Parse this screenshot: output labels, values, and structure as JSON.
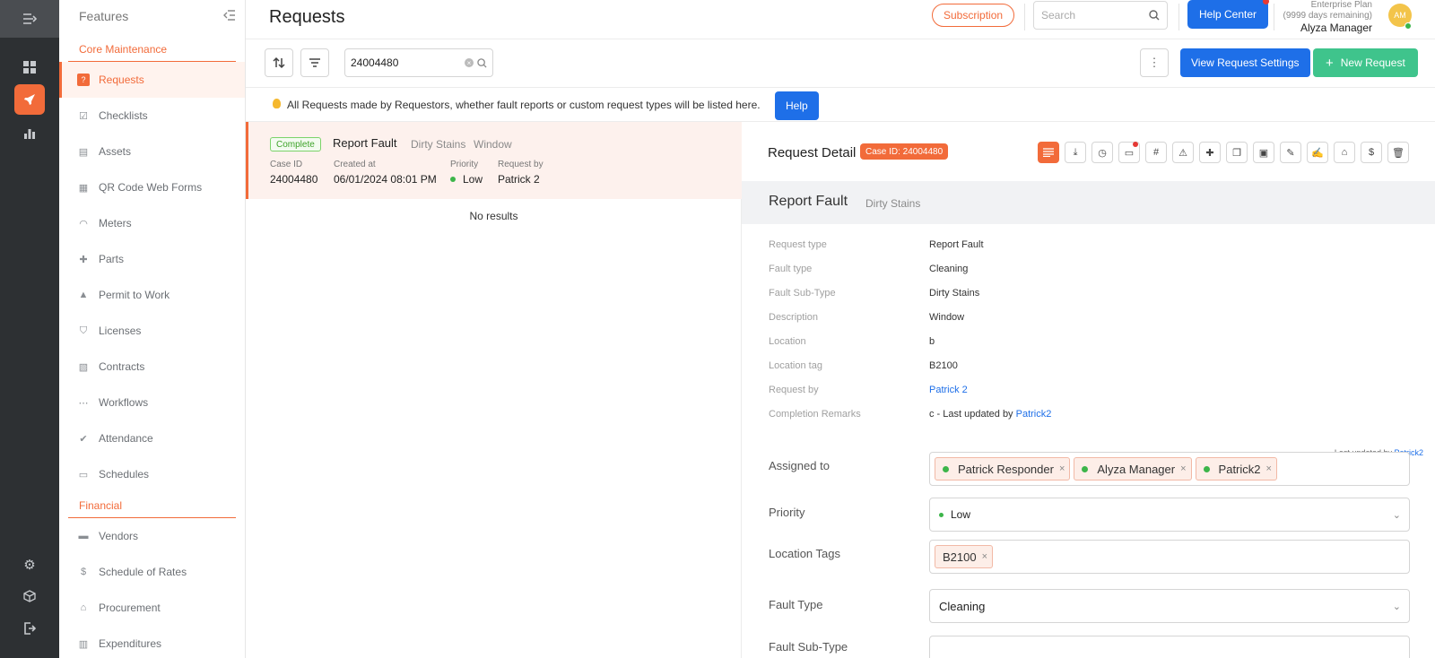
{
  "rail": {
    "icons": [
      "menu-icon",
      "dashboard-icon",
      "rocket-icon",
      "chart-icon",
      "gear-icon",
      "cube-icon",
      "logout-icon"
    ]
  },
  "features": {
    "title": "Features",
    "sections": [
      {
        "title": "Core Maintenance",
        "items": [
          {
            "label": "Requests",
            "icon": "request-icon",
            "active": true
          },
          {
            "label": "Checklists",
            "icon": "checklist-icon"
          },
          {
            "label": "Assets",
            "icon": "asset-icon"
          },
          {
            "label": "QR Code Web Forms",
            "icon": "qr-icon"
          },
          {
            "label": "Meters",
            "icon": "meter-icon"
          },
          {
            "label": "Parts",
            "icon": "puzzle-icon"
          },
          {
            "label": "Permit to Work",
            "icon": "hardhat-icon"
          },
          {
            "label": "Licenses",
            "icon": "shield-icon"
          },
          {
            "label": "Contracts",
            "icon": "contract-icon"
          },
          {
            "label": "Workflows",
            "icon": "workflow-icon"
          },
          {
            "label": "Attendance",
            "icon": "attendance-icon"
          },
          {
            "label": "Schedules",
            "icon": "calendar-icon"
          }
        ]
      },
      {
        "title": "Financial",
        "items": [
          {
            "label": "Vendors",
            "icon": "vendor-icon"
          },
          {
            "label": "Schedule of Rates",
            "icon": "dollar-icon"
          },
          {
            "label": "Procurement",
            "icon": "store-icon"
          },
          {
            "label": "Expenditures",
            "icon": "expenditure-icon"
          }
        ]
      }
    ]
  },
  "header": {
    "title": "Requests",
    "subscription": "Subscription",
    "search_placeholder": "Search",
    "help_center": "Help Center",
    "plan": "Enterprise Plan",
    "plan_days": "(9999 days remaining)",
    "user_name": "Alyza Manager",
    "avatar_initials": "AM"
  },
  "toolbar": {
    "search_value": "24004480",
    "view_settings": "View Request Settings",
    "new_request": "New Request",
    "new_request_icon": "+"
  },
  "info": {
    "text": "All Requests made by Requestors, whether fault reports or custom request types will be listed here.",
    "help": "Help"
  },
  "list": {
    "card": {
      "status": "Complete",
      "type": "Report Fault",
      "sub1": "Dirty Stains",
      "sub2": "Window",
      "case_id_label": "Case ID",
      "case_id": "24004480",
      "created_label": "Created at",
      "created": "06/01/2024 08:01 PM",
      "priority_label": "Priority",
      "priority": "Low",
      "request_by_label": "Request by",
      "request_by": "Patrick 2"
    },
    "no_results": "No results"
  },
  "detail": {
    "title": "Request Detail",
    "case_badge": "Case ID: 24004480",
    "band_title": "Report Fault",
    "band_sub": "Dirty Stains",
    "fields": [
      {
        "label": "Request type",
        "value": "Report Fault"
      },
      {
        "label": "Fault type",
        "value": "Cleaning"
      },
      {
        "label": "Fault Sub-Type",
        "value": "Dirty Stains"
      },
      {
        "label": "Description",
        "value": "Window"
      },
      {
        "label": "Location",
        "value": "b"
      },
      {
        "label": "Location tag",
        "value": "B2100"
      },
      {
        "label": "Request by",
        "value": "Patrick 2"
      },
      {
        "label": "Completion Remarks",
        "value": "c - Last updated by ",
        "link": "Patrick2"
      }
    ],
    "last_updated_prefix": "Last updated by ",
    "last_updated_by": "Patrick2",
    "assigned_label": "Assigned to",
    "assignees": [
      "Patrick Responder",
      "Alyza Manager",
      "Patrick2"
    ],
    "priority_label": "Priority",
    "priority_value": "Low",
    "location_tags_label": "Location Tags",
    "location_tags": [
      "B2100"
    ],
    "fault_type_label": "Fault Type",
    "fault_type_value": "Cleaning",
    "fault_subtype_label": "Fault Sub-Type"
  },
  "colors": {
    "accent": "#f26b3a",
    "primary": "#1e6fe8",
    "success": "#3fc48c",
    "status_green": "#3cb54a"
  }
}
